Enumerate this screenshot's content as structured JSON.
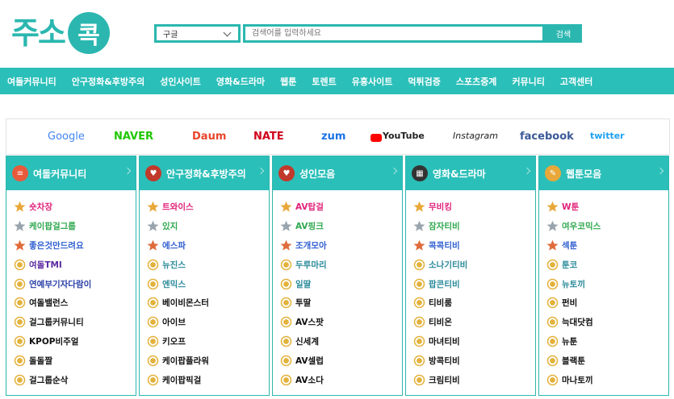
{
  "logo": {
    "text": "주소",
    "badge": "콕"
  },
  "search": {
    "engine": "구글",
    "placeholder": "검색어를 입력하세요",
    "button": "검색"
  },
  "nav": [
    "여돌커뮤니티",
    "안구정화&후방주의",
    "성인사이트",
    "영화&드라마",
    "웹툰",
    "토렌트",
    "유흥사이트",
    "먹튀검증",
    "스포츠중계",
    "커뮤니티",
    "고객센터"
  ],
  "brands": [
    {
      "name": "Google",
      "color": "#4285f4"
    },
    {
      "name": "NAVER",
      "color": "#1ec800"
    },
    {
      "name": "Daum",
      "color": "#e8452c"
    },
    {
      "name": "NATE",
      "color": "#d0021b"
    },
    {
      "name": "zum",
      "color": "#1a73e8"
    },
    {
      "name": "YouTube",
      "color": "#ff0000"
    },
    {
      "name": "Instagram",
      "color": "#222222"
    },
    {
      "name": "facebook",
      "color": "#3b5998"
    },
    {
      "name": "twitter",
      "color": "#1da1f2"
    }
  ],
  "rank_colors": {
    "gold": "#e8a83a",
    "silver": "#9aa4ad",
    "bronze": "#e06b3a",
    "medal": "#e3b23c"
  },
  "cards": [
    {
      "title": "여돌커뮤니티",
      "icon": "chat-bubble-icon",
      "icon_color": "#e85a3c",
      "items": [
        {
          "name": "숏차장",
          "color": "#e0227a"
        },
        {
          "name": "케이팝걸그룹",
          "color": "#2fa84f"
        },
        {
          "name": "좋은것만드려요",
          "color": "#2f5fd0"
        },
        {
          "name": "여돌TMI",
          "color": "#5b2aa0"
        },
        {
          "name": "연예부기자다람이",
          "color": "#2a3fa8"
        },
        {
          "name": "여돌밸런스",
          "color": "#111111"
        },
        {
          "name": "걸그룹커뮤니티",
          "color": "#111111"
        },
        {
          "name": "KPOP비주얼",
          "color": "#111111"
        },
        {
          "name": "돌돌짤",
          "color": "#111111"
        },
        {
          "name": "걸그룹순삭",
          "color": "#111111"
        }
      ]
    },
    {
      "title": "안구정화&후방주의",
      "icon": "heart-icon",
      "icon_color": "#c0392b",
      "items": [
        {
          "name": "트와이스",
          "color": "#e0227a"
        },
        {
          "name": "있지",
          "color": "#2fa84f"
        },
        {
          "name": "에스파",
          "color": "#2f5fd0"
        },
        {
          "name": "뉴진스",
          "color": "#2a8a9a"
        },
        {
          "name": "엔믹스",
          "color": "#2a8a9a"
        },
        {
          "name": "베이비몬스터",
          "color": "#111111"
        },
        {
          "name": "아이브",
          "color": "#111111"
        },
        {
          "name": "키오프",
          "color": "#111111"
        },
        {
          "name": "케이팝플라워",
          "color": "#111111"
        },
        {
          "name": "케이팝픽걸",
          "color": "#111111"
        }
      ]
    },
    {
      "title": "성인모음",
      "icon": "heart-icon",
      "icon_color": "#c0392b",
      "items": [
        {
          "name": "AV탑걸",
          "color": "#e0227a"
        },
        {
          "name": "AV핑크",
          "color": "#2fa84f"
        },
        {
          "name": "조개모아",
          "color": "#2f5fd0"
        },
        {
          "name": "두루마리",
          "color": "#2a8a9a"
        },
        {
          "name": "일딸",
          "color": "#2a8a9a"
        },
        {
          "name": "투딸",
          "color": "#111111"
        },
        {
          "name": "AV스팟",
          "color": "#111111"
        },
        {
          "name": "신세계",
          "color": "#111111"
        },
        {
          "name": "AV셀럽",
          "color": "#111111"
        },
        {
          "name": "AV소다",
          "color": "#111111"
        }
      ]
    },
    {
      "title": "영화&드라마",
      "icon": "clapperboard-icon",
      "icon_color": "#333333",
      "items": [
        {
          "name": "무비킹",
          "color": "#e0227a"
        },
        {
          "name": "잠자티비",
          "color": "#2fa84f"
        },
        {
          "name": "콕콕티비",
          "color": "#2f5fd0"
        },
        {
          "name": "소나기티비",
          "color": "#2a8a9a"
        },
        {
          "name": "팝콘티비",
          "color": "#2a8a9a"
        },
        {
          "name": "티비룸",
          "color": "#111111"
        },
        {
          "name": "티비온",
          "color": "#111111"
        },
        {
          "name": "마녀티비",
          "color": "#111111"
        },
        {
          "name": "방콕티비",
          "color": "#111111"
        },
        {
          "name": "크림티비",
          "color": "#111111"
        }
      ]
    },
    {
      "title": "웹툰모음",
      "icon": "pencil-icon",
      "icon_color": "#e8a83a",
      "items": [
        {
          "name": "W툰",
          "color": "#e0227a"
        },
        {
          "name": "여우코믹스",
          "color": "#2fa84f"
        },
        {
          "name": "섹툰",
          "color": "#2f5fd0"
        },
        {
          "name": "툰코",
          "color": "#2a8a9a"
        },
        {
          "name": "뉴토끼",
          "color": "#2a8a9a"
        },
        {
          "name": "펀비",
          "color": "#111111"
        },
        {
          "name": "늑대닷컴",
          "color": "#111111"
        },
        {
          "name": "뉴툰",
          "color": "#111111"
        },
        {
          "name": "블랙툰",
          "color": "#111111"
        },
        {
          "name": "마나토끼",
          "color": "#111111"
        }
      ]
    }
  ]
}
